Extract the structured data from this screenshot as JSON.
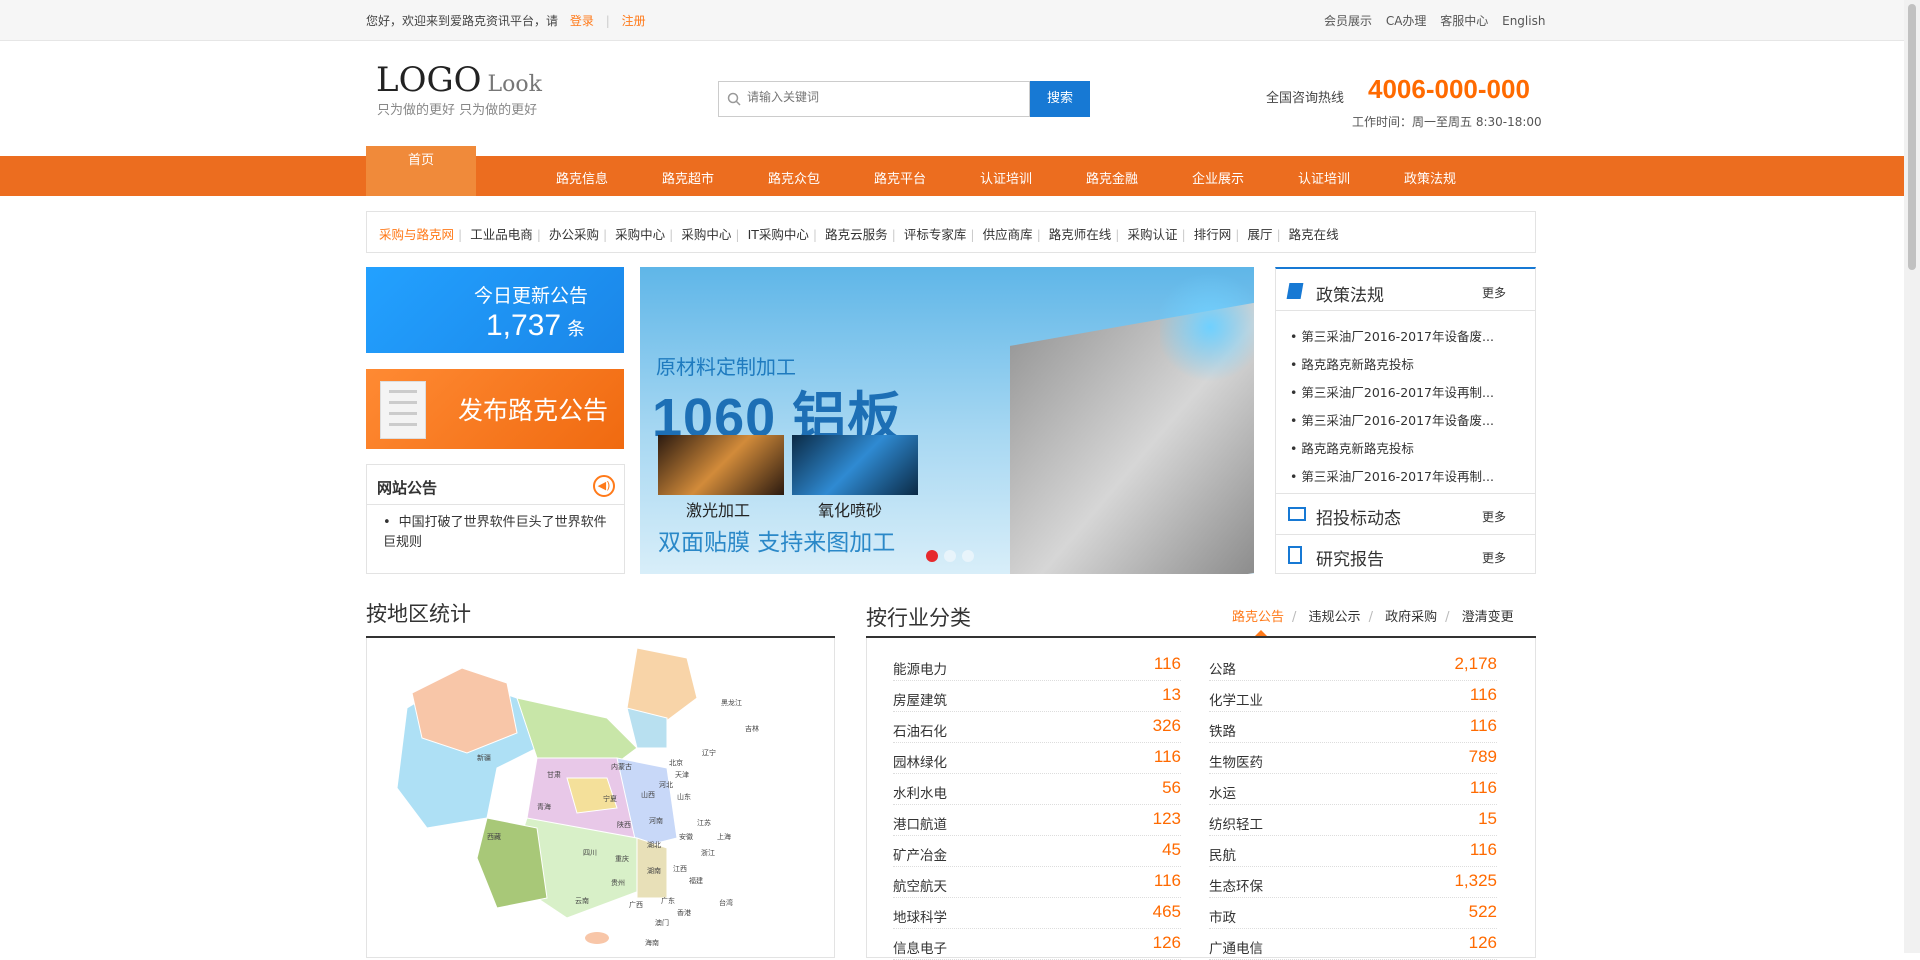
{
  "topbar": {
    "welcome": "您好，欢迎来到爱路克资讯平台，请",
    "login": "登录",
    "register": "注册",
    "links": [
      "会员展示",
      "CA办理",
      "客服中心",
      "English"
    ]
  },
  "header": {
    "logo_main": "LOGO",
    "logo_sub": "Look",
    "slogan": "只为做的更好 只为做的更好",
    "search_placeholder": "请输入关键词",
    "search_button": "搜索",
    "hotline_label": "全国咨询热线",
    "hotline_number": "4006-000-000",
    "work_time": "工作时间：周一至周五 8:30-18:00"
  },
  "nav": {
    "home": "首页",
    "items": [
      "路克信息",
      "路克超市",
      "路克众包",
      "路克平台",
      "认证培训",
      "路克金融",
      "企业展示",
      "认证培训",
      "政策法规"
    ]
  },
  "subcats": [
    "采购与路克网",
    "工业品电商",
    "办公采购",
    "采购中心",
    "采购中心",
    "IT采购中心",
    "路克云服务",
    "评标专家库",
    "供应商库",
    "路克师在线",
    "采购认证",
    "排行网",
    "展厅",
    "路克在线"
  ],
  "today": {
    "label": "今日更新公告",
    "count": "1,737",
    "unit": "条"
  },
  "publish": {
    "label": "发布路克公告"
  },
  "notice": {
    "title": "网站公告",
    "items": [
      "中国打破了世界软件巨头了世界软件巨规则"
    ]
  },
  "banner": {
    "line1": "原材料定制加工",
    "line2": "1060 铝板",
    "caption1": "激光加工",
    "caption2": "氧化喷砂",
    "line3": "双面贴膜 支持来图加工"
  },
  "policy": {
    "title": "政策法规",
    "more": "更多",
    "items": [
      "第三采油厂2016-2017年设备废...",
      "路克路克新路克投标",
      "第三采油厂2016-2017年设再制...",
      "第三采油厂2016-2017年设备废...",
      "路克路克新路克投标",
      "第三采油厂2016-2017年设再制..."
    ]
  },
  "sections": [
    {
      "title": "招投标动态",
      "more": "更多"
    },
    {
      "title": "研究报告",
      "more": "更多"
    }
  ],
  "region": {
    "title": "按地区统计",
    "provinces": [
      "黑龙江",
      "吉林",
      "辽宁",
      "北京",
      "天津",
      "内蒙古",
      "河北",
      "山西",
      "山东",
      "新疆",
      "甘肃",
      "宁夏",
      "青海",
      "陕西",
      "河南",
      "江苏",
      "上海",
      "安徽",
      "湖北",
      "西藏",
      "四川",
      "重庆",
      "浙江",
      "湖南",
      "江西",
      "福建",
      "贵州",
      "云南",
      "广西",
      "广东",
      "台湾",
      "香港",
      "澳门",
      "海南"
    ]
  },
  "industry": {
    "title": "按行业分类",
    "tabs": [
      "路克公告",
      "违规公示",
      "政府采购",
      "澄清变更"
    ],
    "left": [
      {
        "name": "能源电力",
        "value": "116"
      },
      {
        "name": "房屋建筑",
        "value": "13"
      },
      {
        "name": "石油石化",
        "value": "326"
      },
      {
        "name": "园林绿化",
        "value": "116"
      },
      {
        "name": "水利水电",
        "value": "56"
      },
      {
        "name": "港口航道",
        "value": "123"
      },
      {
        "name": "矿产冶金",
        "value": "45"
      },
      {
        "name": "航空航天",
        "value": "116"
      },
      {
        "name": "地球科学",
        "value": "465"
      },
      {
        "name": "信息电子",
        "value": "126"
      }
    ],
    "right": [
      {
        "name": "公路",
        "value": "2,178"
      },
      {
        "name": "化学工业",
        "value": "116"
      },
      {
        "name": "铁路",
        "value": "116"
      },
      {
        "name": "生物医药",
        "value": "789"
      },
      {
        "name": "水运",
        "value": "116"
      },
      {
        "name": "纺织轻工",
        "value": "15"
      },
      {
        "name": "民航",
        "value": "116"
      },
      {
        "name": "生态环保",
        "value": "1,325"
      },
      {
        "name": "市政",
        "value": "522"
      },
      {
        "name": "广通电信",
        "value": "126"
      }
    ]
  },
  "colors": {
    "accent": "#ec6d1f",
    "brand_blue": "#1779d4",
    "number_orange": "#ff6a00"
  }
}
